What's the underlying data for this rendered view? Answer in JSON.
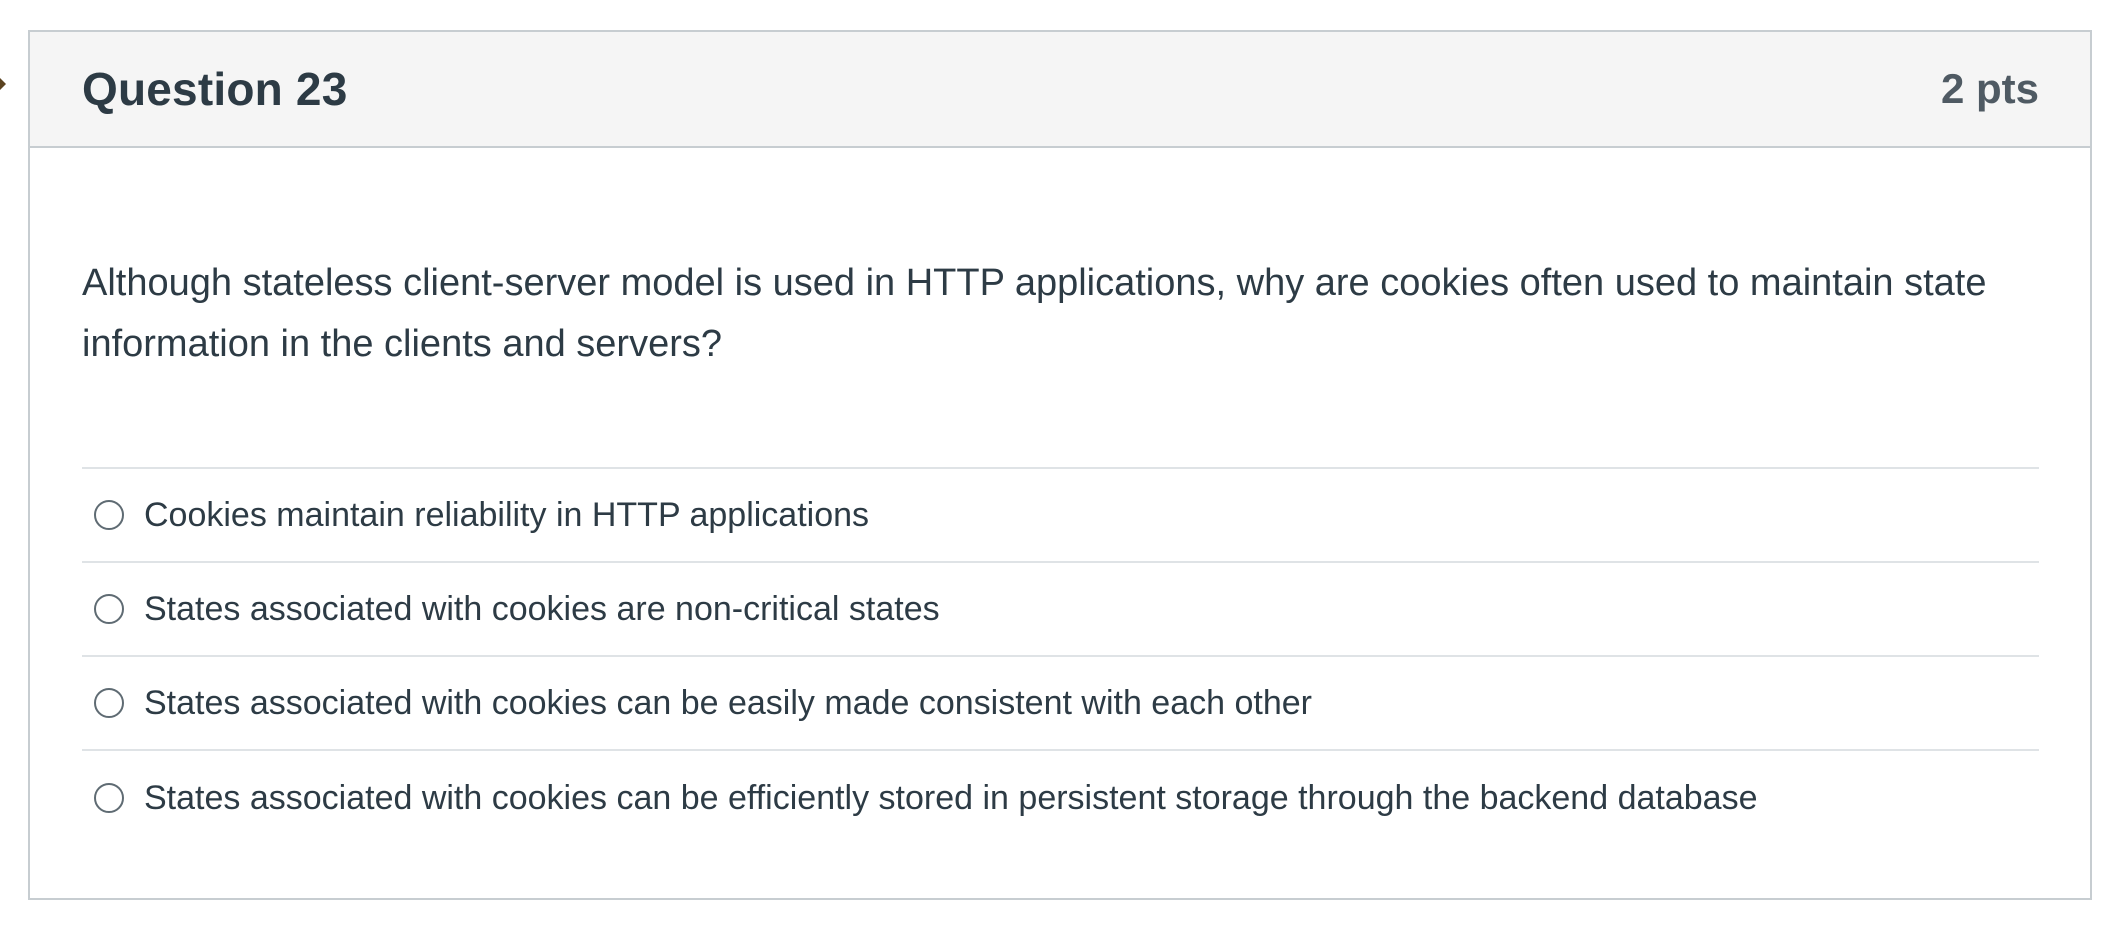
{
  "question": {
    "title": "Question 23",
    "points": "2 pts",
    "text": "Although stateless client-server model is used in HTTP applications, why are cookies often used to maintain state information in the clients and servers?",
    "answers": [
      {
        "label": "Cookies maintain reliability in HTTP applications",
        "selected": false
      },
      {
        "label": "States associated with cookies are non-critical states",
        "selected": false
      },
      {
        "label": "States associated with cookies can be easily made consistent with each other",
        "selected": false
      },
      {
        "label": "States associated with cookies can be efficiently stored in persistent storage through the backend database",
        "selected": false
      }
    ]
  },
  "colors": {
    "header_bg": "#f5f5f5",
    "border": "#c7cdd1",
    "text": "#2d3b45",
    "flag_marker": "#5b4320"
  },
  "icons": {
    "flag": "flag-marker-icon",
    "radio": "radio-button-unchecked"
  }
}
